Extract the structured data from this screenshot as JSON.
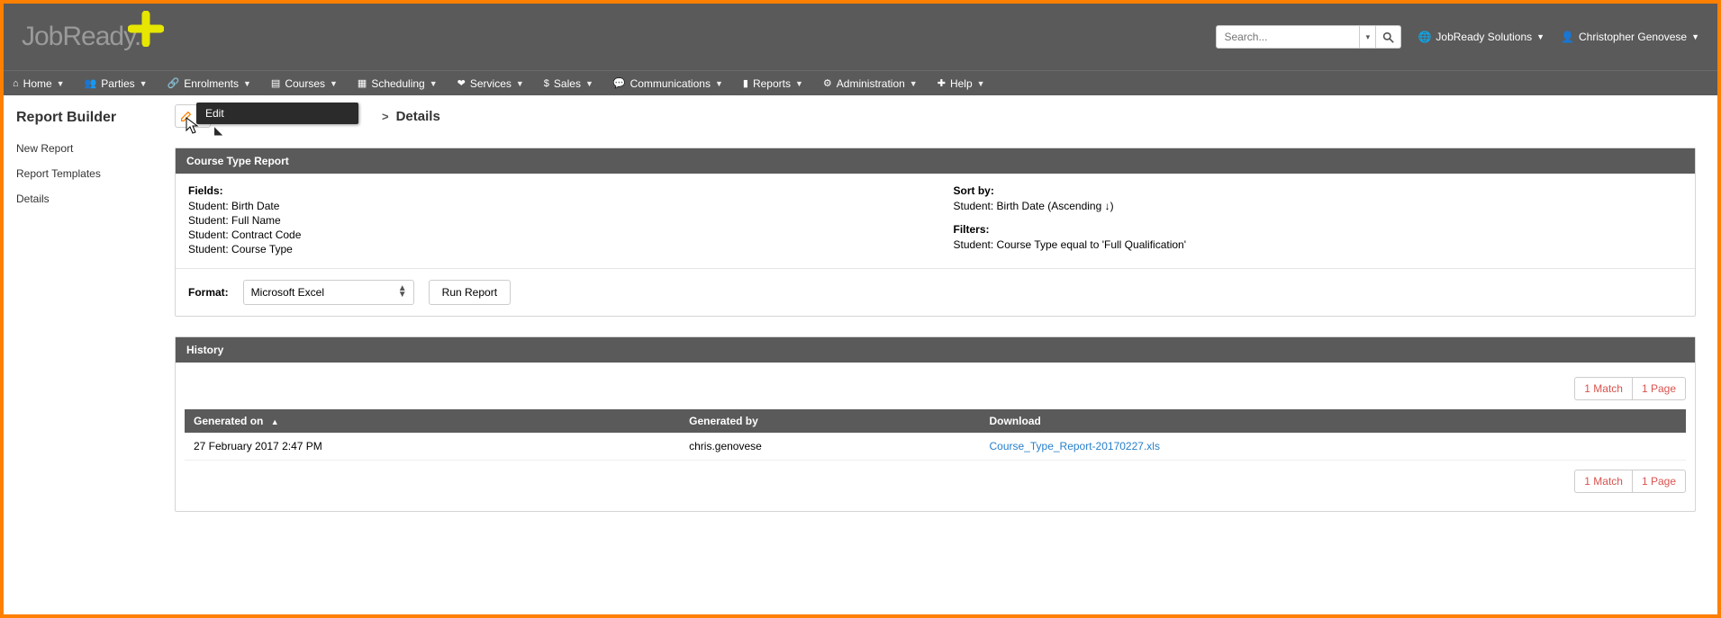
{
  "topbar": {
    "logo_text": "JobReady.",
    "search_placeholder": "Search...",
    "org_label": "JobReady Solutions",
    "user_label": "Christopher Genovese"
  },
  "nav": {
    "items": [
      {
        "icon": "home",
        "label": "Home"
      },
      {
        "icon": "users",
        "label": "Parties"
      },
      {
        "icon": "link",
        "label": "Enrolments"
      },
      {
        "icon": "book",
        "label": "Courses"
      },
      {
        "icon": "calendar",
        "label": "Scheduling"
      },
      {
        "icon": "heart",
        "label": "Services"
      },
      {
        "icon": "dollar",
        "label": "Sales"
      },
      {
        "icon": "comment",
        "label": "Communications"
      },
      {
        "icon": "chart",
        "label": "Reports"
      },
      {
        "icon": "cog",
        "label": "Administration"
      },
      {
        "icon": "plus",
        "label": "Help"
      }
    ]
  },
  "sidebar": {
    "title": "Report Builder",
    "links": [
      {
        "label": "New Report"
      },
      {
        "label": "Report Templates"
      },
      {
        "label": "Details"
      }
    ]
  },
  "crumb": {
    "tooltip": "Edit",
    "sep": ">",
    "current": "Details"
  },
  "report": {
    "title": "Course Type Report",
    "fields_label": "Fields:",
    "fields": [
      "Student: Birth Date",
      "Student: Full Name",
      "Student: Contract Code",
      "Student: Course Type"
    ],
    "sort_label": "Sort by:",
    "sort": "Student: Birth Date (Ascending ↓)",
    "filters_label": "Filters:",
    "filters": "Student: Course Type equal to 'Full Qualification'",
    "format_label": "Format:",
    "format_value": "Microsoft Excel",
    "run_label": "Run Report"
  },
  "history": {
    "title": "History",
    "match_label": "1 Match",
    "page_label": "1 Page",
    "columns": {
      "generated_on": "Generated on",
      "generated_by": "Generated by",
      "download": "Download"
    },
    "rows": [
      {
        "generated_on": "27 February 2017 2:47 PM",
        "generated_by": "chris.genovese",
        "download": "Course_Type_Report-20170227.xls"
      }
    ]
  }
}
